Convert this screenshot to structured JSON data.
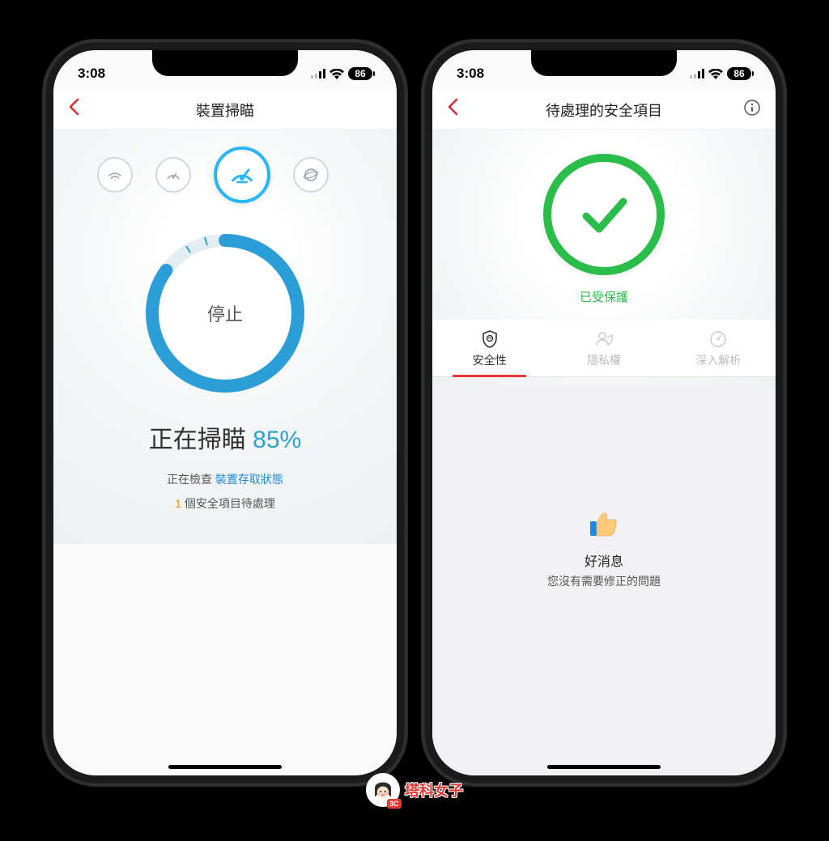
{
  "status": {
    "time": "3:08",
    "battery": "86"
  },
  "left": {
    "title": "裝置掃瞄",
    "ring_label": "停止",
    "scanning_label": "正在掃瞄",
    "scanning_percent": "85%",
    "progress_value": 85,
    "checking_prefix": "正在檢查",
    "checking_item": "裝置存取狀態",
    "pending_count": "1",
    "pending_suffix": "個安全項目待處理"
  },
  "right": {
    "title": "待處理的安全項目",
    "protected": "已受保護",
    "tabs": {
      "security": "安全性",
      "privacy": "隱私權",
      "analysis": "深入解析"
    },
    "good_title": "好消息",
    "good_sub": "您沒有需要修正的問題"
  },
  "watermark": {
    "text": "塔科女子",
    "badge": "3C"
  }
}
